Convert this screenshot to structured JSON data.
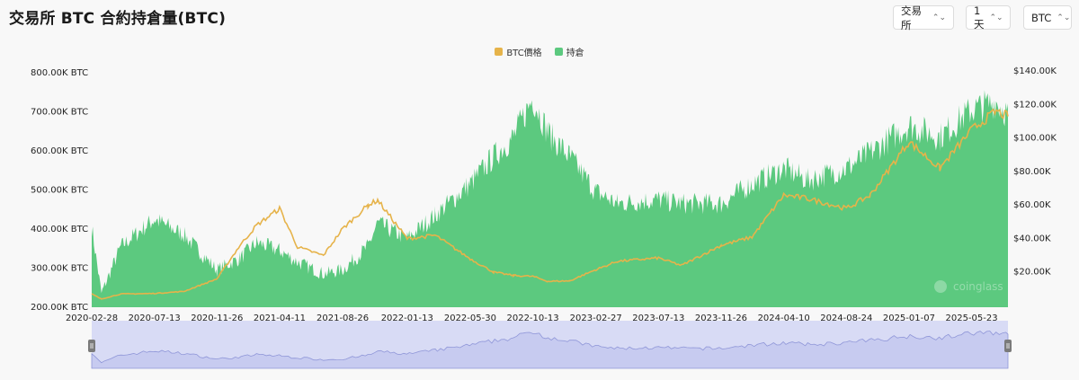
{
  "header": {
    "title": "交易所 BTC 合約持倉量(BTC)"
  },
  "controls": [
    {
      "label": "交易所",
      "chevron": "⌃⌄"
    },
    {
      "label": "1天",
      "chevron": "⌃⌄"
    },
    {
      "label": "BTC",
      "chevron": "⌃⌄"
    }
  ],
  "colors": {
    "price": "#e6b34a",
    "oi": "#5cc97f",
    "navigator_fill": "#d8dbf5",
    "navigator_line": "#8f96d8"
  },
  "watermark": "coinglass",
  "chart_data": {
    "type": "area",
    "title": "",
    "legend": [
      "BTC價格",
      "持倉"
    ],
    "legend_position": "top-center",
    "x_ticks": [
      "2020-02-28",
      "2020-07-13",
      "2020-11-26",
      "2021-04-11",
      "2021-08-26",
      "2022-01-13",
      "2022-05-30",
      "2022-10-13",
      "2023-02-27",
      "2023-07-13",
      "2023-11-26",
      "2024-04-10",
      "2024-08-24",
      "2025-01-07",
      "2025-05-23"
    ],
    "left_axis": {
      "ticks": [
        "200.00K BTC",
        "300.00K BTC",
        "400.00K BTC",
        "500.00K BTC",
        "600.00K BTC",
        "700.00K BTC",
        "800.00K BTC"
      ],
      "range": [
        200000,
        800000
      ]
    },
    "right_axis": {
      "ticks": [
        "$20.00K",
        "$40.00K",
        "$60.00K",
        "$80.00K",
        "$100.00K",
        "$120.00K",
        "$140.00K"
      ],
      "range": [
        0,
        140000
      ]
    },
    "grid": false,
    "series": [
      {
        "name": "持倉",
        "axis": "left",
        "type": "area",
        "x": [
          "2020-02-28",
          "2020-03-20",
          "2020-05-01",
          "2020-07-13",
          "2020-09-15",
          "2020-11-26",
          "2021-01-15",
          "2021-02-20",
          "2021-04-11",
          "2021-05-20",
          "2021-07-15",
          "2021-08-26",
          "2021-10-20",
          "2021-11-10",
          "2022-01-13",
          "2022-03-15",
          "2022-05-30",
          "2022-07-20",
          "2022-09-01",
          "2022-10-13",
          "2022-11-15",
          "2023-01-01",
          "2023-02-27",
          "2023-04-15",
          "2023-07-13",
          "2023-09-01",
          "2023-11-26",
          "2024-02-01",
          "2024-04-10",
          "2024-06-01",
          "2024-08-24",
          "2024-10-15",
          "2025-01-07",
          "2025-03-15",
          "2025-05-23",
          "2025-07-15",
          "2025-08-10"
        ],
        "values": [
          410000,
          240000,
          360000,
          430000,
          390000,
          300000,
          330000,
          370000,
          350000,
          320000,
          290000,
          300000,
          360000,
          420000,
          380000,
          440000,
          520000,
          590000,
          640000,
          740000,
          650000,
          590000,
          500000,
          470000,
          480000,
          470000,
          470000,
          520000,
          560000,
          530000,
          560000,
          600000,
          670000,
          640000,
          710000,
          730000,
          700000
        ]
      },
      {
        "name": "BTC價格",
        "axis": "right",
        "type": "line",
        "x": [
          "2020-02-28",
          "2020-03-20",
          "2020-05-01",
          "2020-07-13",
          "2020-09-15",
          "2020-11-26",
          "2021-01-15",
          "2021-02-20",
          "2021-04-11",
          "2021-05-20",
          "2021-07-15",
          "2021-08-26",
          "2021-10-20",
          "2021-11-10",
          "2022-01-13",
          "2022-03-15",
          "2022-05-30",
          "2022-07-20",
          "2022-09-01",
          "2022-10-13",
          "2022-11-15",
          "2023-01-01",
          "2023-02-27",
          "2023-04-15",
          "2023-07-13",
          "2023-09-01",
          "2023-11-26",
          "2024-02-01",
          "2024-04-10",
          "2024-06-01",
          "2024-08-24",
          "2024-10-15",
          "2025-01-07",
          "2025-03-15",
          "2025-05-23",
          "2025-07-15",
          "2025-08-10"
        ],
        "values": [
          9000,
          6000,
          9000,
          9300,
          10500,
          18000,
          38000,
          50000,
          60000,
          37000,
          32000,
          48000,
          62000,
          65000,
          42000,
          44000,
          30000,
          22000,
          20000,
          19500,
          16500,
          16800,
          23500,
          28500,
          30500,
          26000,
          38000,
          43000,
          68000,
          66000,
          60000,
          68000,
          100000,
          84000,
          107000,
          118000,
          115000
        ]
      }
    ]
  }
}
